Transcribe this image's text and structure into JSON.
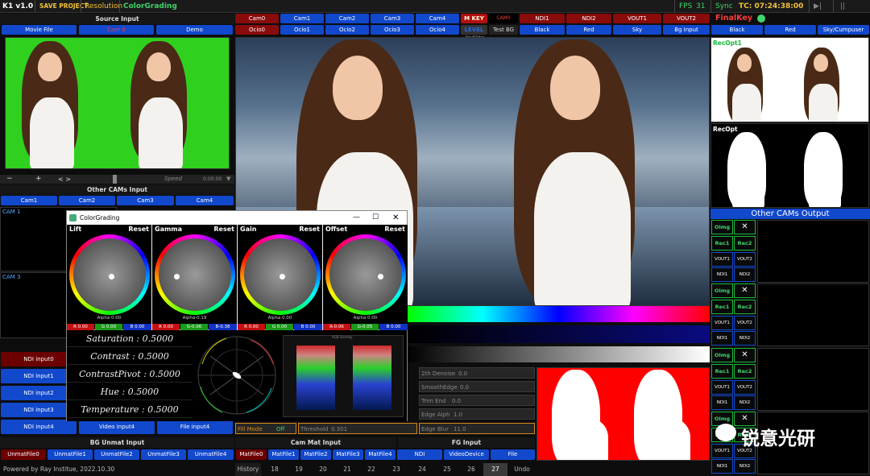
{
  "topbar": {
    "version": "K1 v1.0",
    "save": "SAVE PROJECT",
    "resolution": "Resolution",
    "colorgrading": "ColorGrading",
    "fps": "FPS",
    "fps_value": "31",
    "sync": "Sync",
    "timecode": "TC: 07:24:38:00",
    "play": "▶|",
    "pause": "||"
  },
  "source": {
    "title": "Source Input",
    "buttons": [
      "Movie File",
      "Cam 0",
      "Demo"
    ],
    "transport": [
      "−",
      "+",
      "< >"
    ],
    "speed": "Speed",
    "time": "0:00:00"
  },
  "othercams": {
    "title": "Other CAMs Input",
    "buttons": [
      "Cam1",
      "Cam2",
      "Cam3",
      "Cam4"
    ],
    "labels": [
      "CAM 1",
      "CAM 3"
    ]
  },
  "camrow1": [
    "Cam0",
    "Cam1",
    "Cam2",
    "Cam3",
    "Cam4"
  ],
  "camrow2": [
    "Ocio0",
    "Ocio1",
    "Ocio2",
    "Ocio3",
    "Ocio4"
  ],
  "mkey": "M KEY",
  "level": "LEVEL",
  "cam0_small": "CAM0",
  "testbg": "Test BG",
  "keyslider": "KeySlider",
  "outrow1": [
    "NDI1",
    "NDI2",
    "VOUT1",
    "VOUT2"
  ],
  "outrow2": [
    "Black",
    "Red",
    "Sky",
    "Bg Input"
  ],
  "finalkey": {
    "title": "FinalKey",
    "buttons": [
      "Black",
      "Red",
      "Sky/Cumpuser"
    ]
  },
  "recopt": [
    "RecOpt1",
    "RecOpt"
  ],
  "otherout": {
    "title": "Other CAMs Output",
    "oimg": "OImg",
    "x": "✕",
    "rec1": "Rec1",
    "rec2": "Rec2",
    "vout1": "VOUT1",
    "vout2": "VOUT2",
    "ndi1": "NDI1",
    "ndi2": "NDI2"
  },
  "ndi": {
    "inputs": [
      "NDI input0",
      "NDI input1",
      "NDI input2",
      "NDI input3",
      "NDI input4"
    ],
    "video4": "Video input4",
    "file4": "File input4"
  },
  "colorgrading": {
    "title": "ColorGrading",
    "wheels": [
      {
        "name": "Lift",
        "reset": "Reset",
        "alpha": "Alpha 0.00",
        "r": "R 0.00",
        "g": "G 0.00",
        "b": "B 0.00"
      },
      {
        "name": "Gamma",
        "reset": "Reset",
        "alpha": "Alpha-0.19",
        "r": "R 0.00",
        "g": "G-0.06",
        "b": "B-0.38"
      },
      {
        "name": "Gain",
        "reset": "Reset",
        "alpha": "Alpha 0.00",
        "r": "R 0.00",
        "g": "G 0.00",
        "b": "B 0.00"
      },
      {
        "name": "Offset",
        "reset": "Reset",
        "alpha": "Alpha 0.00",
        "r": "R-0.06",
        "g": "G-0.05",
        "b": "B 0.00"
      }
    ],
    "params": [
      "Saturation : 0.5000",
      "Contrast : 0.5000",
      "ContrastPivot : 0.5000",
      "Hue : 0.5000",
      "Temperature : 0.5000"
    ],
    "scope_label": "RGB Overlay"
  },
  "keyctrl": {
    "denoise": "2th Denoise",
    "denoise_v": "0.0",
    "smooth": "SmoothEdge",
    "smooth_v": "0.0",
    "trim": "Trim End",
    "trim_v": "0.0",
    "edgealph": "Edge Alph",
    "edgealph_v": "1.0",
    "fillmode": "Fill Mode",
    "fill_v": "Off",
    "threshold": "Threshold",
    "threshold_v": "0.301",
    "edgeblur": "Edge Blur",
    "edgeblur_v": "11.0"
  },
  "bgunmat": {
    "title": "BG Unmat Input",
    "buttons": [
      "UnmatFile0",
      "UnmatFile1",
      "UnmatFile2",
      "UnmatFile3",
      "UnmatFile4"
    ]
  },
  "cammat": {
    "title": "Cam Mat Input",
    "buttons": [
      "MatFile0",
      "MatFile1",
      "MatFile2",
      "MatFile3",
      "MatFile4",
      "NDI"
    ]
  },
  "fginput": {
    "title": "FG Input",
    "buttons": [
      "VideoDevice",
      "File"
    ]
  },
  "footer": {
    "powered": "Powered by Ray Institue, 2022.10.30",
    "history": "History",
    "nums": [
      "18",
      "19",
      "20",
      "21",
      "22",
      "23",
      "24",
      "25",
      "26",
      "27"
    ],
    "undo": "Undo"
  },
  "watermark": "锐意光研",
  "colors": {
    "accent": "#1148cc",
    "red": "#8a0b0b",
    "green": "#18b83a",
    "greenscreen": "#2fd11e"
  }
}
